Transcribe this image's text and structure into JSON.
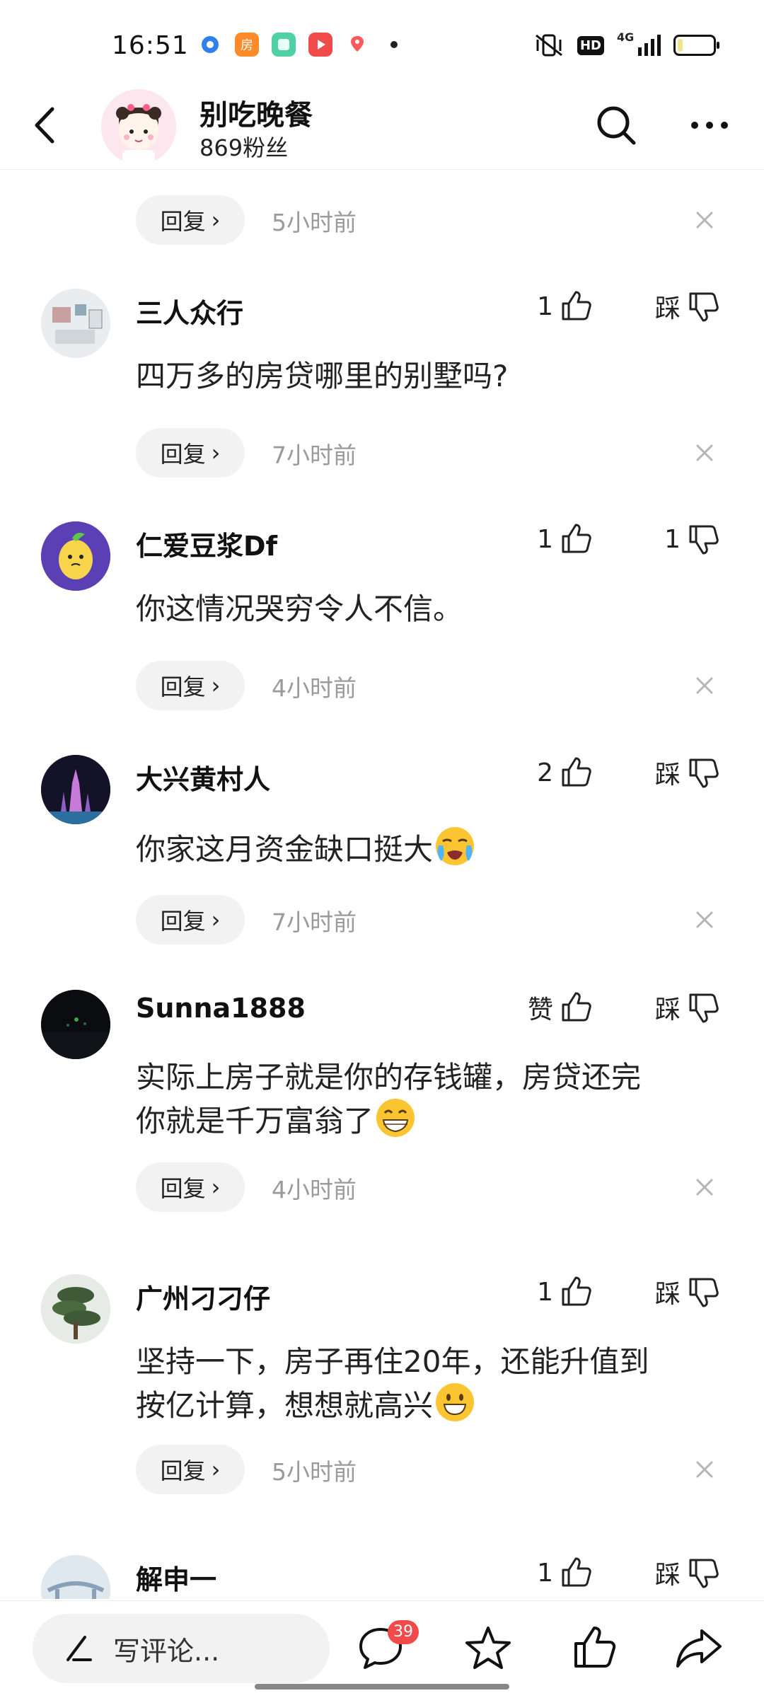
{
  "status_bar": {
    "time": "16:51",
    "apps": [
      {
        "icon": "circle-app-icon",
        "color": "#3b82f6",
        "glyph": "●"
      },
      {
        "icon": "house-app-icon",
        "color": "#ff8a2a",
        "glyph": "房"
      },
      {
        "icon": "square-app-icon",
        "color": "#4fd1a5",
        "glyph": "■"
      },
      {
        "icon": "play-app-icon",
        "color": "#f04a4a",
        "glyph": "▶"
      },
      {
        "icon": "map-pin-app-icon",
        "color": "#ff5a5a",
        "glyph": "●"
      }
    ],
    "hd_label": "HD",
    "network_label": "4G",
    "battery_level": 0.15
  },
  "header": {
    "name": "别吃晚餐",
    "fans": "869粉丝"
  },
  "partial_top": {
    "reply_label": "回复",
    "time": "5小时前"
  },
  "comments": [
    {
      "name": "三人众行",
      "text": "四万多的房贷哪里的别墅吗?",
      "likes": "1",
      "dislikes": "踩",
      "reply_label": "回复",
      "time": "7小时前",
      "avatar_color": "#dfe6ea"
    },
    {
      "name": "仁爱豆浆Df",
      "text": "你这情况哭穷令人不信。",
      "likes": "1",
      "dislikes": "1",
      "reply_label": "回复",
      "time": "4小时前",
      "avatar_color": "#5b3fb5"
    },
    {
      "name": "大兴黄村人",
      "text": "你家这月资金缺口挺大",
      "likes": "2",
      "dislikes": "踩",
      "reply_label": "回复",
      "time": "7小时前",
      "avatar_color": "#1a1630"
    },
    {
      "name": "Sunna1888",
      "text_line1": "实际上房子就是你的存钱罐，房贷还完",
      "text_line2": "你就是千万富翁了",
      "likes": "赞",
      "dislikes": "踩",
      "reply_label": "回复",
      "time": "4小时前",
      "avatar_color": "#0d0f12"
    },
    {
      "name": "广州刁刁仔",
      "text_line1": "坚持一下，房子再住20年，还能升值到",
      "text_line2": "按亿计算，想想就高兴",
      "likes": "1",
      "dislikes": "踩",
      "reply_label": "回复",
      "time": "5小时前",
      "avatar_color": "#7c8a78"
    },
    {
      "name": "解申一",
      "likes": "1",
      "dislikes": "踩",
      "avatar_color": "#c9d6e6"
    }
  ],
  "bottom_bar": {
    "input_placeholder": "写评论...",
    "comment_count": "39"
  }
}
